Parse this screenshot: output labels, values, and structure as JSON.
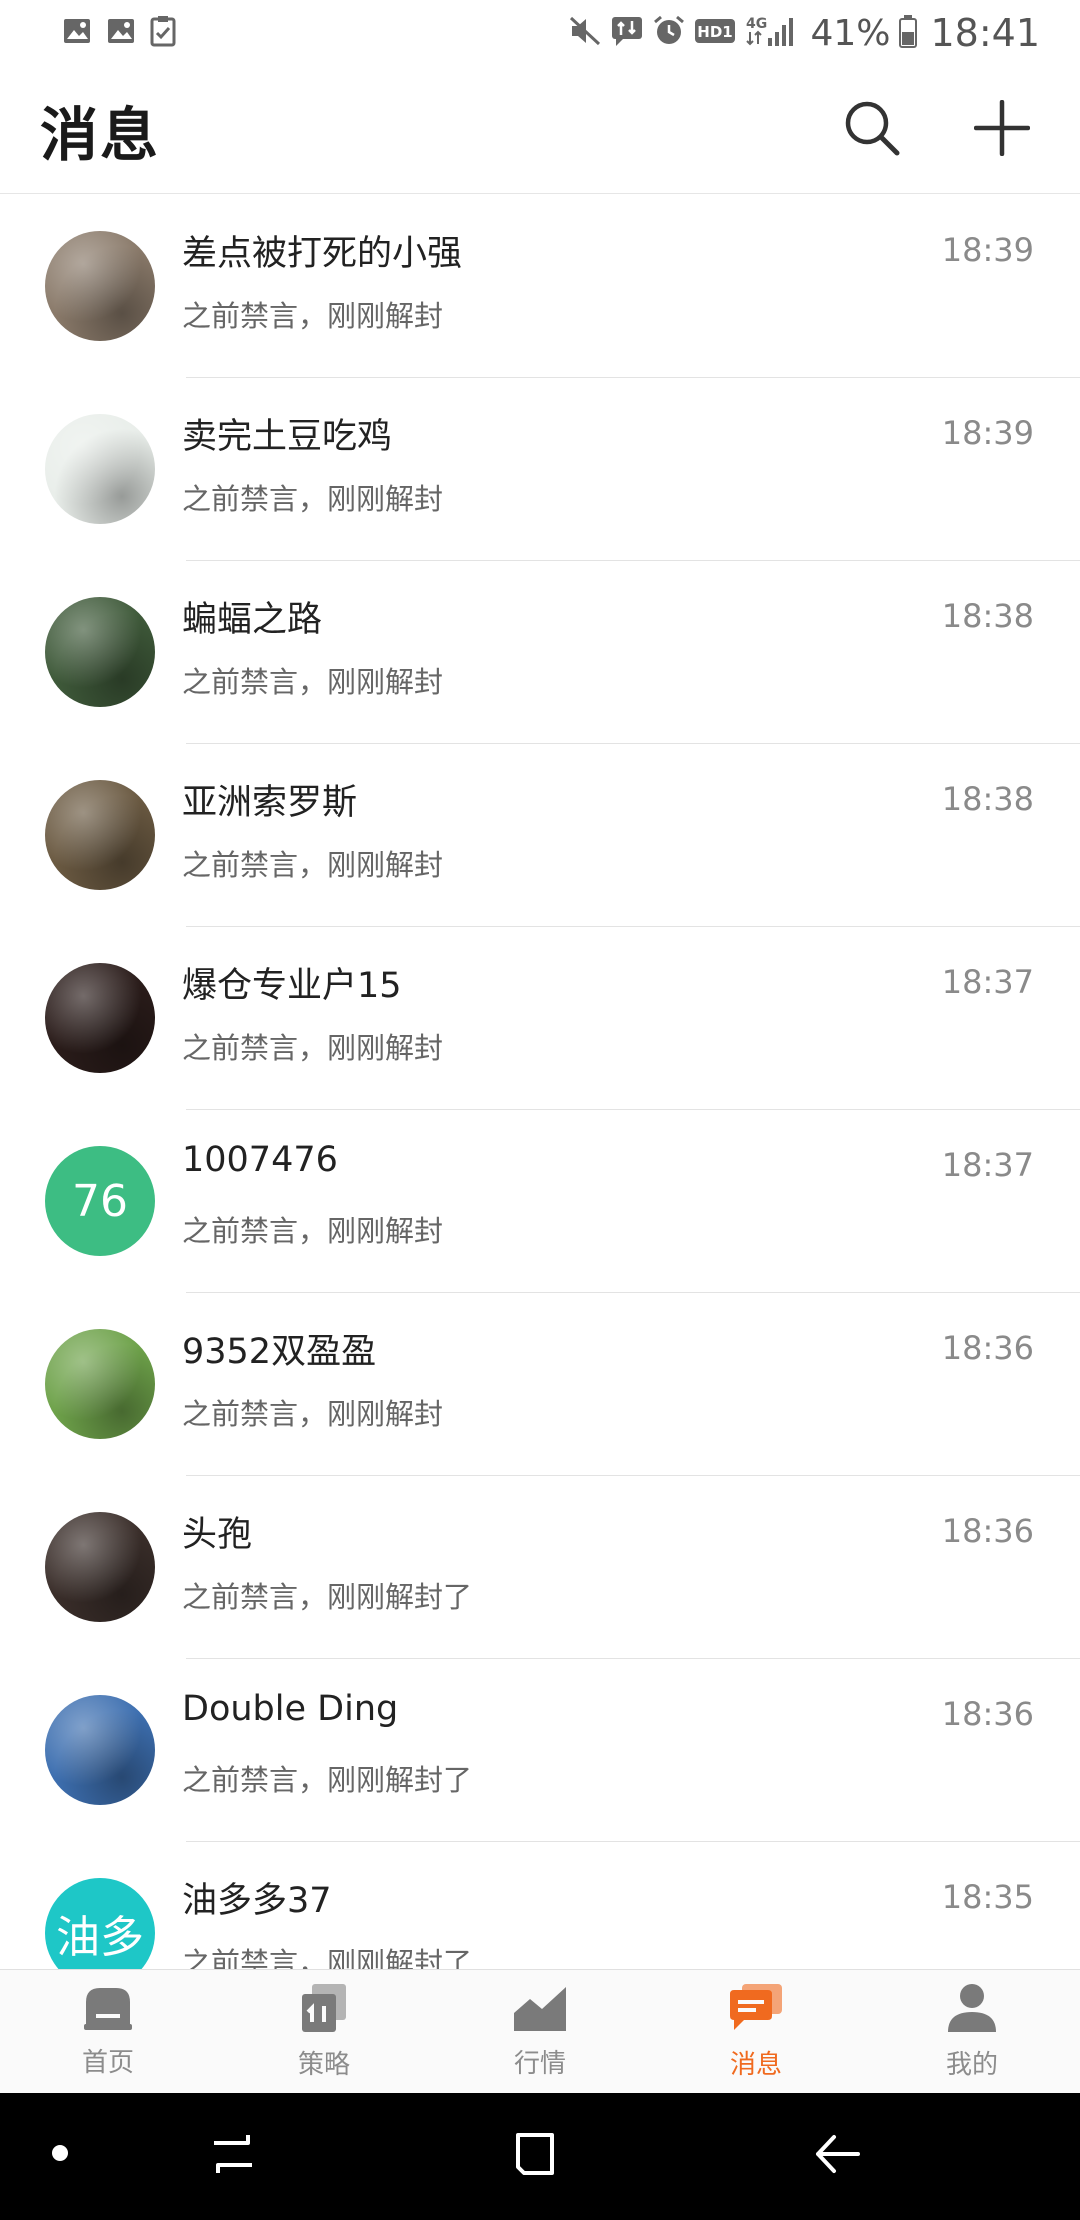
{
  "status_bar": {
    "battery": "41%",
    "time": "18:41",
    "left_icons": [
      "image-icon",
      "image-icon",
      "clipboard-check-icon"
    ],
    "right_icons": [
      "mute-icon",
      "data-sync-icon",
      "alarm-icon",
      "hd-icon",
      "4g-signal-icon",
      "battery-icon"
    ],
    "hd_label": "HD1",
    "net_label": "4G"
  },
  "header": {
    "title": "消息",
    "search_icon": "search-icon",
    "add_icon": "plus-icon"
  },
  "conversations": [
    {
      "name": "差点被打死的小强",
      "preview": "之前禁言，刚刚解封",
      "time": "18:39",
      "avatar": "image",
      "avatar_bg": "#8a7a6a"
    },
    {
      "name": "卖完土豆吃鸡",
      "preview": "之前禁言，刚刚解封",
      "time": "18:39",
      "avatar": "image",
      "avatar_bg": "#e9eeea"
    },
    {
      "name": "蝙蝠之路",
      "preview": "之前禁言，刚刚解封",
      "time": "18:38",
      "avatar": "image",
      "avatar_bg": "#3f5a3a"
    },
    {
      "name": "亚洲索罗斯",
      "preview": "之前禁言，刚刚解封",
      "time": "18:38",
      "avatar": "image",
      "avatar_bg": "#6b5a42"
    },
    {
      "name": "爆仓专业户15",
      "preview": "之前禁言，刚刚解封",
      "time": "18:37",
      "avatar": "image",
      "avatar_bg": "#2a1c1a"
    },
    {
      "name": "1007476",
      "preview": "之前禁言，刚刚解封",
      "time": "18:37",
      "avatar": "text",
      "avatar_text": "76",
      "avatar_bg": "#3dbd83"
    },
    {
      "name": "9352双盈盈",
      "preview": "之前禁言，刚刚解封",
      "time": "18:36",
      "avatar": "image",
      "avatar_bg": "#6ea24a"
    },
    {
      "name": "头孢",
      "preview": "之前禁言，刚刚解封了",
      "time": "18:36",
      "avatar": "image",
      "avatar_bg": "#3a2e2a"
    },
    {
      "name": "Double Ding",
      "preview": "之前禁言，刚刚解封了",
      "time": "18:36",
      "avatar": "image",
      "avatar_bg": "#3d6fb0"
    },
    {
      "name": "油多多37",
      "preview": "之前禁言，刚刚解封了",
      "time": "18:35",
      "avatar": "text",
      "avatar_text": "油多",
      "avatar_bg": "#1ec7c7"
    }
  ],
  "tabs": [
    {
      "label": "首页",
      "icon": "home-icon",
      "active": false
    },
    {
      "label": "策略",
      "icon": "strategy-icon",
      "active": false
    },
    {
      "label": "行情",
      "icon": "market-chart-icon",
      "active": false
    },
    {
      "label": "消息",
      "icon": "chat-icon",
      "active": true
    },
    {
      "label": "我的",
      "icon": "profile-icon",
      "active": false
    }
  ],
  "colors": {
    "accent": "#f06a1f",
    "tab_inactive": "#8c8c8c",
    "divider": "#e3e3e3"
  },
  "nav_bar": {
    "buttons": [
      "dot-icon",
      "recents-icon",
      "home-square-icon",
      "back-icon"
    ]
  }
}
